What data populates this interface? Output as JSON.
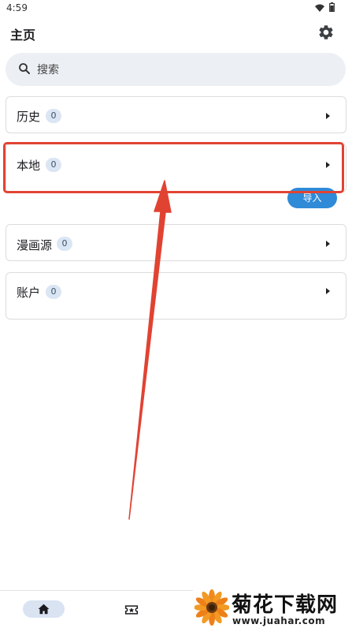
{
  "status_bar": {
    "time": "4:59"
  },
  "header": {
    "title": "主页"
  },
  "search": {
    "placeholder": "搜索"
  },
  "sections": [
    {
      "title": "历史",
      "count": "0"
    },
    {
      "title": "本地",
      "count": "0",
      "action_label": "导入"
    },
    {
      "title": "漫画源",
      "count": "0"
    },
    {
      "title": "账户",
      "count": "0"
    }
  ],
  "annotation": {
    "color": "#e14332"
  },
  "accent": {
    "primary": "#2f8ad8",
    "badge_bg": "#dbe6f4",
    "nav_active_bg": "#d9e3f2"
  },
  "bottom_nav": {
    "items": [
      "home-icon",
      "ticket-star-icon"
    ]
  },
  "watermark": {
    "title": "菊花下载网",
    "url": "www.juahar.com"
  }
}
